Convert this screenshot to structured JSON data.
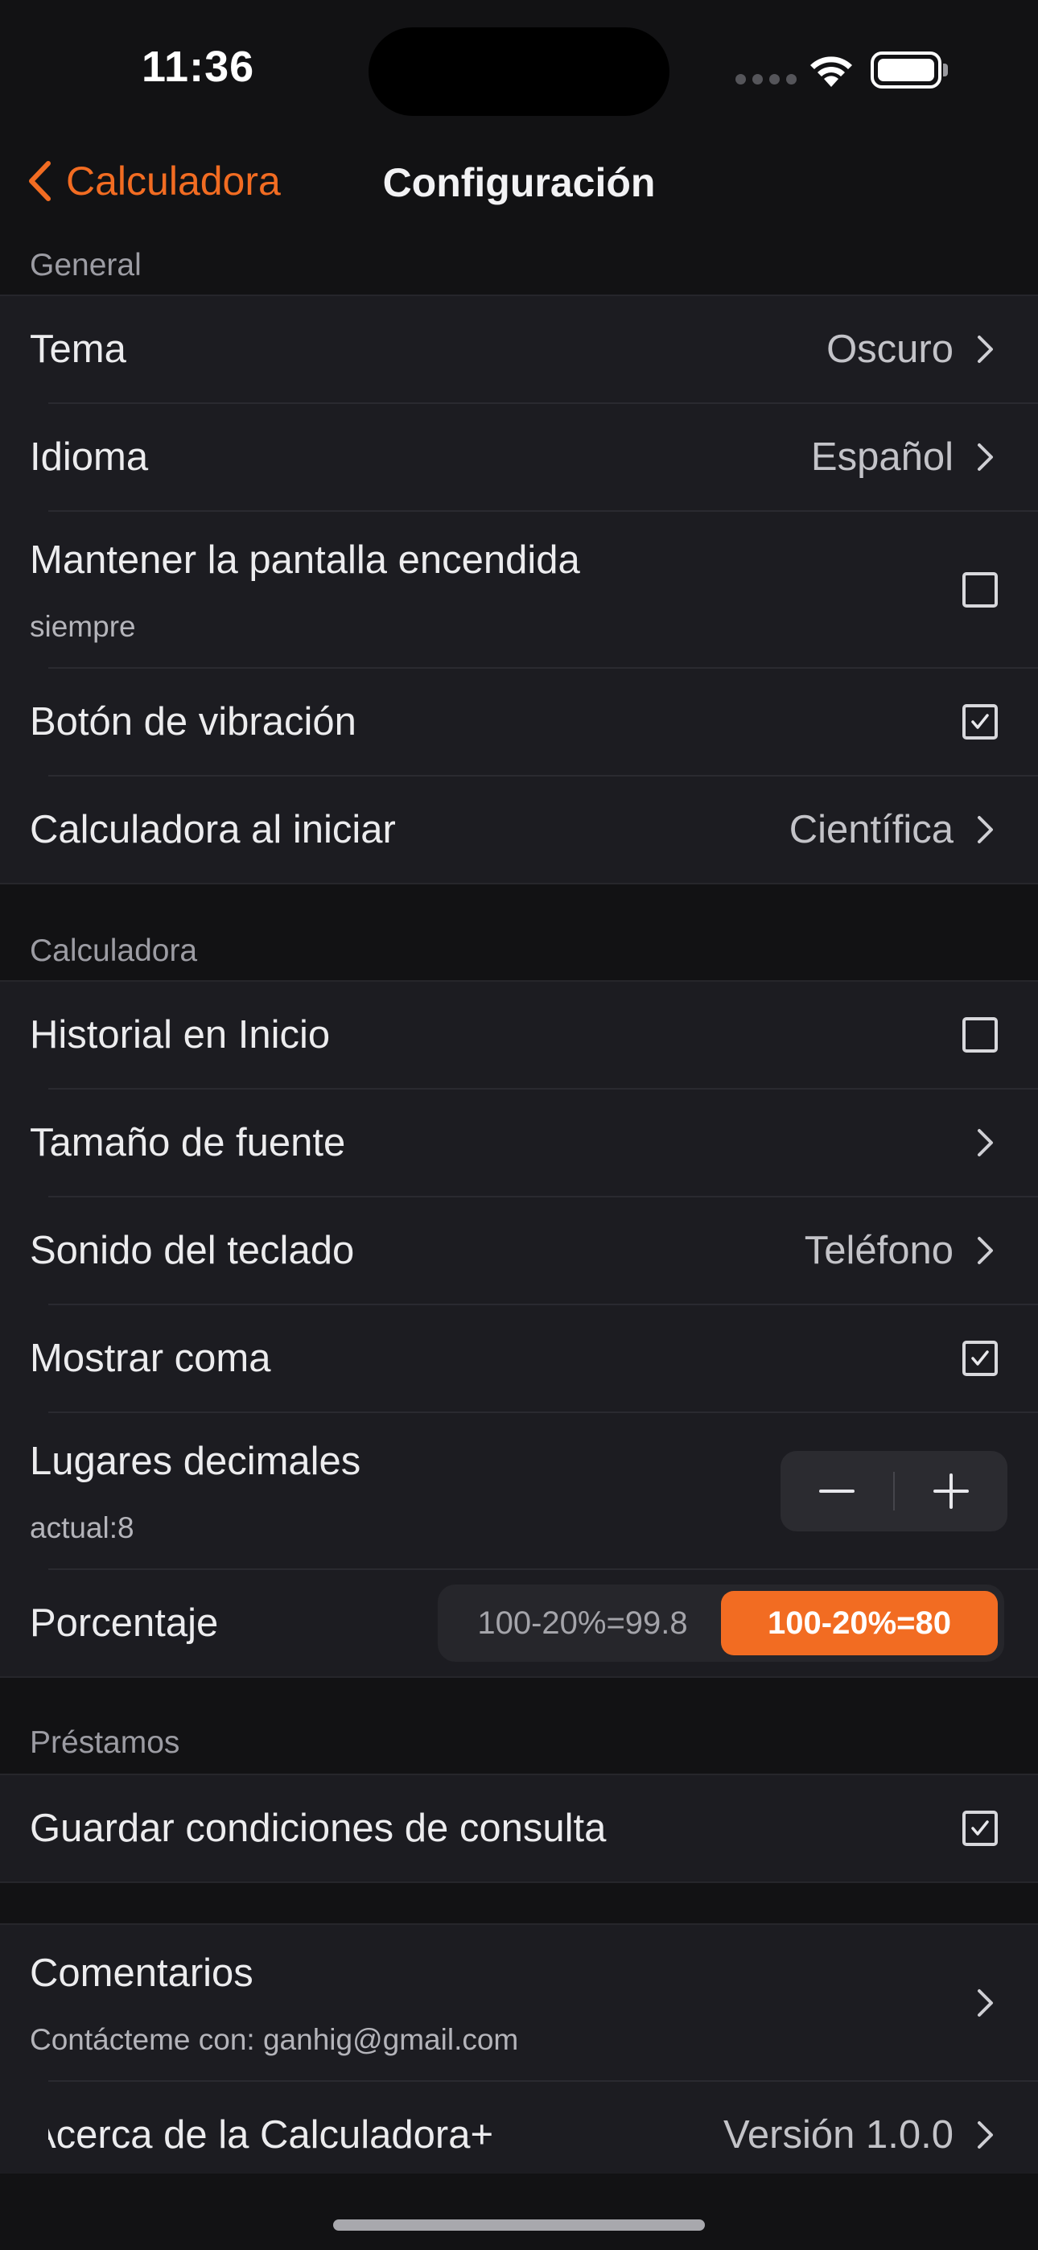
{
  "status": {
    "time": "11:36"
  },
  "nav": {
    "back_label": "Calculadora",
    "title": "Configuración"
  },
  "sections": {
    "general": "General",
    "calculadora": "Calculadora",
    "prestamos": "Préstamos"
  },
  "general": {
    "tema": {
      "label": "Tema",
      "value": "Oscuro"
    },
    "idioma": {
      "label": "Idioma",
      "value": "Español"
    },
    "pantalla": {
      "label": "Mantener la pantalla encendida",
      "sub": "siempre",
      "checked": false
    },
    "vibracion": {
      "label": "Botón de vibración",
      "checked": true
    },
    "inicio": {
      "label": "Calculadora al iniciar",
      "value": "Científica"
    }
  },
  "calc": {
    "historial": {
      "label": "Historial en Inicio",
      "checked": false
    },
    "fuente": {
      "label": "Tamaño de fuente"
    },
    "sonido": {
      "label": "Sonido del teclado",
      "value": "Teléfono"
    },
    "coma": {
      "label": "Mostrar coma",
      "checked": true
    },
    "decimales": {
      "label": "Lugares decimales",
      "sub": "actual:8"
    },
    "porcentaje": {
      "label": "Porcentaje",
      "option_a": "100-20%=99.8",
      "option_b": "100-20%=80",
      "selected": "option_b"
    }
  },
  "prestamos": {
    "guardar": {
      "label": "Guardar condiciones de consulta",
      "checked": true
    }
  },
  "otros": {
    "comentarios": {
      "label": "Comentarios",
      "sub": "Contácteme con: ganhig@gmail.com"
    },
    "acerca": {
      "label": "Acerca de la Calculadora+",
      "value": "Versión 1.0.0"
    }
  },
  "colors": {
    "accent": "#f26c22",
    "background": "#121214",
    "cell": "#1c1c21"
  }
}
